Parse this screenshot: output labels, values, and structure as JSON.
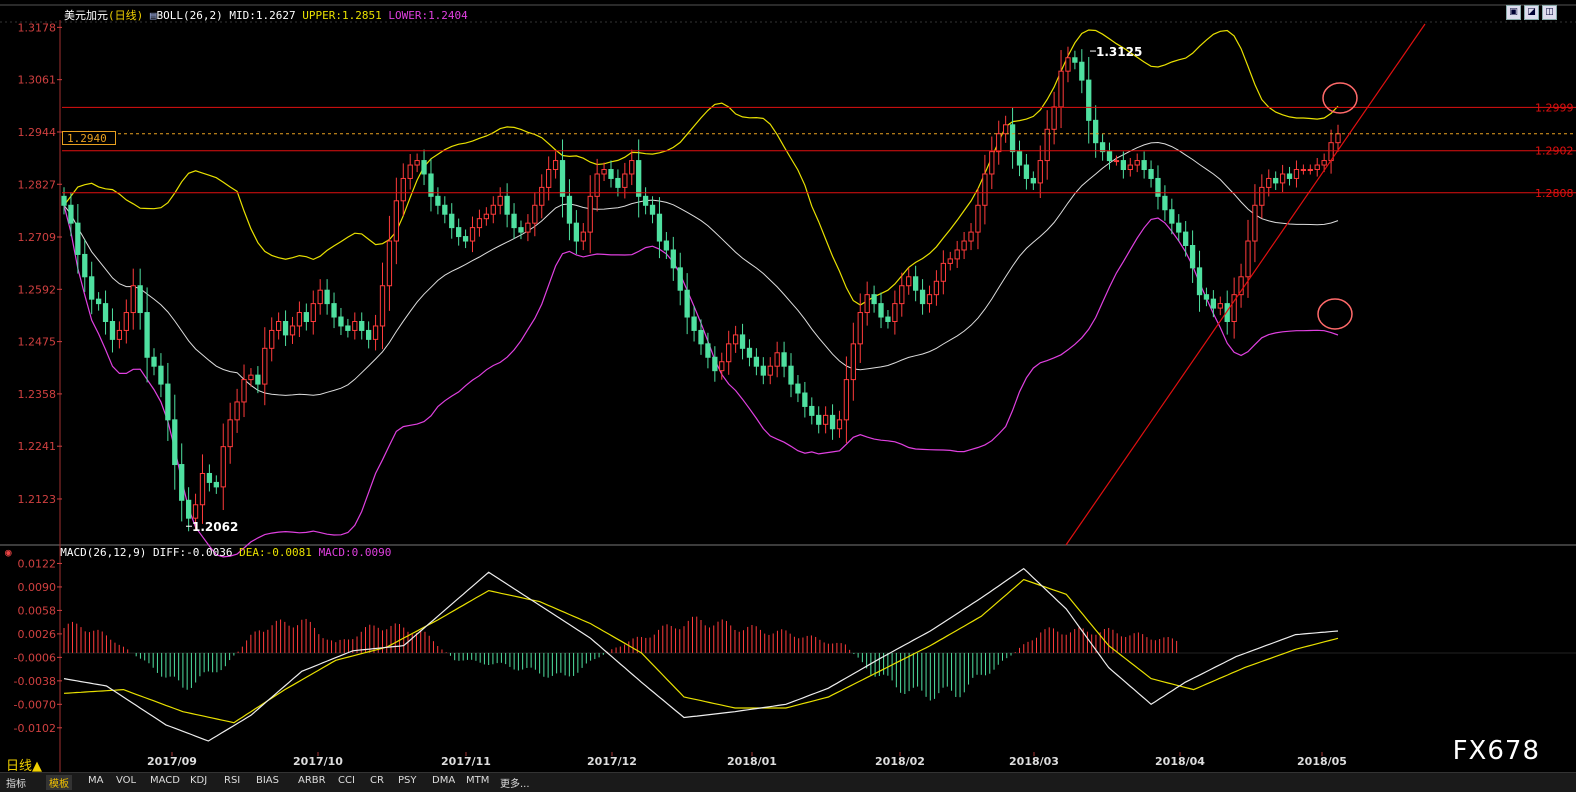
{
  "header": {
    "symbol": "美元加元",
    "period_label": "(日线)",
    "boll_label": "BOLL(26,2)",
    "mid": "MID:1.2627",
    "upper": "UPPER:1.2851",
    "lower": "LOWER:1.2404"
  },
  "macd_header": {
    "label": "MACD(26,12,9)",
    "diff": "DIFF:-0.0036",
    "dea": "DEA:-0.0081",
    "macd": "MACD:0.0090"
  },
  "current_price": "1.2940",
  "period_selector": "日线▲",
  "watermark": "FX678",
  "tabs": [
    "指标",
    "模板",
    "MA",
    "VOL",
    "MACD",
    "KDJ",
    "RSI",
    "BIAS",
    "ARBR",
    "CCI",
    "CR",
    "PSY",
    "DMA",
    "MTM",
    "更多..."
  ],
  "window_buttons": [
    "▣",
    "◪",
    "◫"
  ],
  "colors": {
    "up": "#ff3b3b",
    "down": "#4fe0a0",
    "upper": "#e8e000",
    "mid": "#dddddd",
    "lower": "#e040e0",
    "level": "#e01010",
    "axis": "#d04040"
  },
  "chart_data": [
    {
      "type": "candlestick",
      "name": "USDCAD daily with Bollinger Bands",
      "y_ticks": [
        1.3178,
        1.3061,
        1.2944,
        1.2827,
        1.2709,
        1.2592,
        1.2475,
        1.2358,
        1.2241,
        1.2123
      ],
      "ylim": [
        1.202,
        1.319
      ],
      "x_labels": [
        "2017/09",
        "2017/10",
        "2017/11",
        "2017/12",
        "2018/01",
        "2018/02",
        "2018/03",
        "2018/04",
        "2018/05"
      ],
      "annotations": [
        {
          "text": "1.3125",
          "value": 1.3125,
          "date": "2018/03 high"
        },
        {
          "text": "1.2062",
          "value": 1.2062,
          "date": "2017/09 low"
        }
      ],
      "horizontal_levels": [
        {
          "label": "1.2999",
          "value": 1.2999
        },
        {
          "label": "1.2902",
          "value": 1.2902
        },
        {
          "label": "1.2808",
          "value": 1.2808
        }
      ],
      "current_price_line": 1.294,
      "closes": [
        1.278,
        1.274,
        1.267,
        1.262,
        1.257,
        1.256,
        1.252,
        1.248,
        1.25,
        1.254,
        1.26,
        1.254,
        1.244,
        1.242,
        1.238,
        1.23,
        1.22,
        1.212,
        1.208,
        1.211,
        1.218,
        1.216,
        1.215,
        1.224,
        1.23,
        1.234,
        1.239,
        1.24,
        1.238,
        1.246,
        1.25,
        1.252,
        1.249,
        1.251,
        1.254,
        1.252,
        1.256,
        1.259,
        1.256,
        1.253,
        1.251,
        1.25,
        1.252,
        1.25,
        1.248,
        1.251,
        1.26,
        1.27,
        1.279,
        1.284,
        1.287,
        1.288,
        1.285,
        1.28,
        1.278,
        1.276,
        1.273,
        1.271,
        1.27,
        1.273,
        1.275,
        1.276,
        1.278,
        1.28,
        1.276,
        1.273,
        1.272,
        1.274,
        1.278,
        1.282,
        1.286,
        1.288,
        1.28,
        1.274,
        1.27,
        1.272,
        1.28,
        1.285,
        1.286,
        1.284,
        1.282,
        1.285,
        1.288,
        1.28,
        1.278,
        1.276,
        1.27,
        1.268,
        1.264,
        1.259,
        1.253,
        1.25,
        1.247,
        1.244,
        1.241,
        1.243,
        1.247,
        1.249,
        1.246,
        1.244,
        1.242,
        1.24,
        1.242,
        1.245,
        1.242,
        1.238,
        1.236,
        1.233,
        1.231,
        1.229,
        1.231,
        1.228,
        1.23,
        1.239,
        1.247,
        1.254,
        1.258,
        1.256,
        1.253,
        1.252,
        1.256,
        1.26,
        1.262,
        1.259,
        1.256,
        1.258,
        1.261,
        1.265,
        1.266,
        1.268,
        1.27,
        1.272,
        1.278,
        1.285,
        1.29,
        1.294,
        1.296,
        1.29,
        1.287,
        1.284,
        1.283,
        1.288,
        1.295,
        1.3,
        1.308,
        1.311,
        1.31,
        1.306,
        1.297,
        1.292,
        1.29,
        1.288,
        1.288,
        1.286,
        1.287,
        1.288,
        1.286,
        1.284,
        1.28,
        1.277,
        1.274,
        1.272,
        1.269,
        1.264,
        1.258,
        1.257,
        1.255,
        1.256,
        1.252,
        1.258,
        1.262,
        1.27,
        1.278,
        1.282,
        1.284,
        1.283,
        1.285,
        1.284,
        1.286,
        1.286,
        1.286,
        1.287,
        1.288,
        1.292,
        1.294
      ]
    },
    {
      "type": "bar+line",
      "name": "MACD",
      "y_ticks": [
        0.0122,
        0.009,
        0.0058,
        0.0026,
        -0.0006,
        -0.0038,
        -0.007,
        -0.0102
      ],
      "ylim": [
        -0.0135,
        0.0124
      ],
      "hist_profile": [
        [
          0,
          0.004
        ],
        [
          4,
          0.0045
        ],
        [
          12,
          0.002
        ],
        [
          18,
          -0.001
        ],
        [
          28,
          -0.0055
        ],
        [
          38,
          -0.002
        ],
        [
          46,
          0.004
        ],
        [
          56,
          0.0052
        ],
        [
          64,
          0.0015
        ],
        [
          74,
          0.0045
        ],
        [
          84,
          0.0035
        ],
        [
          92,
          -0.001
        ],
        [
          104,
          -0.002
        ],
        [
          118,
          -0.004
        ],
        [
          130,
          0.001
        ],
        [
          144,
          0.0045
        ],
        [
          150,
          0.0052
        ],
        [
          160,
          0.004
        ],
        [
          172,
          0.003
        ],
        [
          184,
          0.0012
        ],
        [
          190,
          -0.003
        ],
        [
          200,
          -0.0065
        ],
        [
          210,
          -0.0065
        ],
        [
          222,
          -0.001
        ],
        [
          230,
          0.0035
        ],
        [
          245,
          0.0035
        ],
        [
          262,
          0.002
        ]
      ],
      "diff_profile": [
        [
          0,
          -0.0035
        ],
        [
          10,
          -0.0045
        ],
        [
          24,
          -0.0098
        ],
        [
          34,
          -0.012
        ],
        [
          44,
          -0.0085
        ],
        [
          56,
          -0.0025
        ],
        [
          68,
          0.0003
        ],
        [
          80,
          0.001
        ],
        [
          90,
          0.006
        ],
        [
          100,
          0.011
        ],
        [
          112,
          0.0065
        ],
        [
          124,
          0.002
        ],
        [
          136,
          -0.004
        ],
        [
          146,
          -0.0088
        ],
        [
          158,
          -0.008
        ],
        [
          170,
          -0.007
        ],
        [
          180,
          -0.0048
        ],
        [
          192,
          -0.0008
        ],
        [
          204,
          0.003
        ],
        [
          216,
          0.0075
        ],
        [
          226,
          0.0115
        ],
        [
          236,
          0.006
        ],
        [
          246,
          -0.002
        ],
        [
          256,
          -0.007
        ],
        [
          264,
          -0.004
        ],
        [
          276,
          -0.0005
        ],
        [
          290,
          0.0025
        ],
        [
          300,
          0.003
        ]
      ],
      "dea_profile": [
        [
          0,
          -0.0055
        ],
        [
          14,
          -0.005
        ],
        [
          28,
          -0.008
        ],
        [
          40,
          -0.0095
        ],
        [
          52,
          -0.005
        ],
        [
          64,
          -0.001
        ],
        [
          76,
          0.0008
        ],
        [
          88,
          0.0045
        ],
        [
          100,
          0.0085
        ],
        [
          112,
          0.007
        ],
        [
          124,
          0.004
        ],
        [
          136,
          0.0
        ],
        [
          146,
          -0.006
        ],
        [
          158,
          -0.0075
        ],
        [
          170,
          -0.0075
        ],
        [
          180,
          -0.006
        ],
        [
          192,
          -0.0025
        ],
        [
          204,
          0.001
        ],
        [
          216,
          0.005
        ],
        [
          226,
          0.01
        ],
        [
          236,
          0.008
        ],
        [
          246,
          0.001
        ],
        [
          256,
          -0.0035
        ],
        [
          266,
          -0.005
        ],
        [
          278,
          -0.002
        ],
        [
          290,
          0.0005
        ],
        [
          300,
          0.002
        ]
      ]
    }
  ]
}
